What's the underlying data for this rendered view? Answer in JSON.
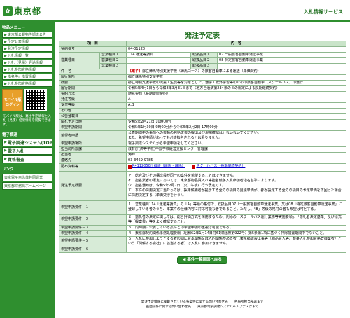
{
  "header": {
    "logo_mark": "✿",
    "logo_text": "東京都",
    "service_title": "入札情報サービス"
  },
  "sidebar": {
    "menu_heading": "物品メニュー",
    "items": [
      "東京都公報物件調達公告",
      "予定公表情報",
      "発注予定情報",
      "入札情報一覧",
      "入札（見積）経過情報",
      "入札参加資格情報",
      "指名停止措置情報",
      "入札参加資格情報"
    ],
    "mobile_button": "モバイル版",
    "mobile_button_sub": "ログイン",
    "mobile_note": "モバイル版は、発注予定情報と入札（見積）結果情報を閲覧できます。",
    "link_heading": "電子調達",
    "big_items": [
      "電子調達システム(TOP)",
      "電子入札",
      "資格審査"
    ],
    "links_heading": "リンク",
    "links": [
      "東京電子自治体共同運営",
      "東京都財務局ホームページ"
    ]
  },
  "main": {
    "page_title": "発注予定表",
    "col_item": "項　目",
    "col_content": "内　容",
    "contract_no_label": "契約番号",
    "contract_no": "04-01120",
    "business_type_label": "営業種目",
    "business_rows": [
      {
        "label": "営業種目１",
        "value": "114 運送等請負",
        "tlabel": "取扱品目１",
        "tvalue": "07 一般旅客自動車運送事業"
      },
      {
        "label": "営業種目２",
        "value": "",
        "tlabel": "取扱品目２",
        "tvalue": "08 特定旅客自動車運送事業"
      },
      {
        "label": "営業種目３",
        "value": "",
        "tlabel": "取扱品目３",
        "tvalue": ""
      }
    ],
    "subject_label": "件　名",
    "subject_tag": "【電子】",
    "subject": "都立練馬特別支援学校（練馬コース）の旅客自動車による運送（単価契約）",
    "fields": [
      {
        "label": "履行場所",
        "value": "都立練馬特別支援学校"
      },
      {
        "label": "概要",
        "value": "都立特別支援学校の児童・生徒等を対象とした、通学・校外学習等のための旅客自動車（スクールバス）の運行"
      },
      {
        "label": "履行期間",
        "value": "令和5年4月1日から令和8年3月31日まで（地方自治法第234条の３の規定による長期継続契約）"
      },
      {
        "label": "契約方法",
        "value": "随意契約（長期継続契約）"
      },
      {
        "label": "発注等級",
        "value": "A"
      },
      {
        "label": "受付等級",
        "value": "A,B"
      },
      {
        "label": "その他",
        "value": ""
      },
      {
        "label": "公告登載日",
        "value": ""
      },
      {
        "label": "開札予定日時",
        "value": "令和5年2月21日 10時00分"
      },
      {
        "label": "希望申請期間",
        "value": "令和5年1月30日 9時00分から令和5年2月2日 17時00分"
      },
      {
        "label": "希望者申請",
        "value": "公表期間中の事前への書類の包括文書の提出及び現場確認は行ないないでください。\nまた、希望申請があっても必ず指名されるとは限りません。"
      },
      {
        "label": "希望申請場所",
        "value": "電子調達システムから希望申請をしてください。"
      },
      {
        "label": "担当局所部課",
        "value": "教育庁(高等学校)中部学校経営支援センター管理課"
      },
      {
        "label": "担当者",
        "value": "海鋒"
      },
      {
        "label": "連絡先",
        "value": "03-3469-9785"
      }
    ],
    "attachments_label": "配布資料等",
    "attachments": [
      "R4112050仕様書（練馬・練馬）",
      "スクールバス（長期継続契約）"
    ],
    "order_label": "発注予定概要",
    "order_text": "ア　総合及びその構成員が同一の案件を希望することはできません。\nイ　指名業者の選定においては、東京都物品買入れ等指名競争入札参加者指名基準によります。\nウ　指名通知は、令和5年2月7日（火）午後に行う予定です。\nエ　本件の採用決定に当たっては、採用候補者が提示する全ての項目の見積単価が、都が設定する全ての項目の予定単価を下回った場合に採用決定する（単価交渉を行う）。",
    "conditions": [
      {
        "label": "希望申請要件－１",
        "value": "１　営業種目114「運送等請負」の「A」等級の格付で、取扱品目07「一般旅客自動車運送事業」又は08「特定旅客自動車運送事業」に登録している者のうち、本案件の仕様内容に対応可能な者であること。ただし、「B」等級の格付の者も希望は可とする。"
      },
      {
        "label": "希望申請要件－２",
        "value": "２　落札者の決定に関しては、総合評価方式を採用するため、別添の「スクールバス運行業務等実施要領」、「落札者決定基準」及び様式等「提案書」等をよく確認すること。"
      },
      {
        "label": "希望申請要件－３",
        "value": "３　同時期に公表している案件との希望申請の重複は可能である。"
      },
      {
        "label": "希望申請要件－４",
        "value": "４　東京都契約関係事務処理要綱（昭和62年1月14日付61財経庶第922号）第5条第1項に基づく排除措置期間中でないこと。"
      },
      {
        "label": "希望申請要件－５",
        "value": "５　入札に参加しようとする者の間に資本関係又は人的関係がある者（東京都建設工事等（物品買入等）競争入札参加資格登録業者）という「関係する会社」に該当する者）は入札に参加できません。"
      },
      {
        "label": "希望申請要件－６",
        "value": ""
      }
    ],
    "list_button": "案件一覧画面へ戻る"
  },
  "footer": {
    "line1": "発注予定情報に掲載されている各案件に関する問い合わせ先　　各局所担当部署まで",
    "line2": "画面操作に関する問い合わせ先　　東京都電子調達システムヘルプデスクまで"
  }
}
